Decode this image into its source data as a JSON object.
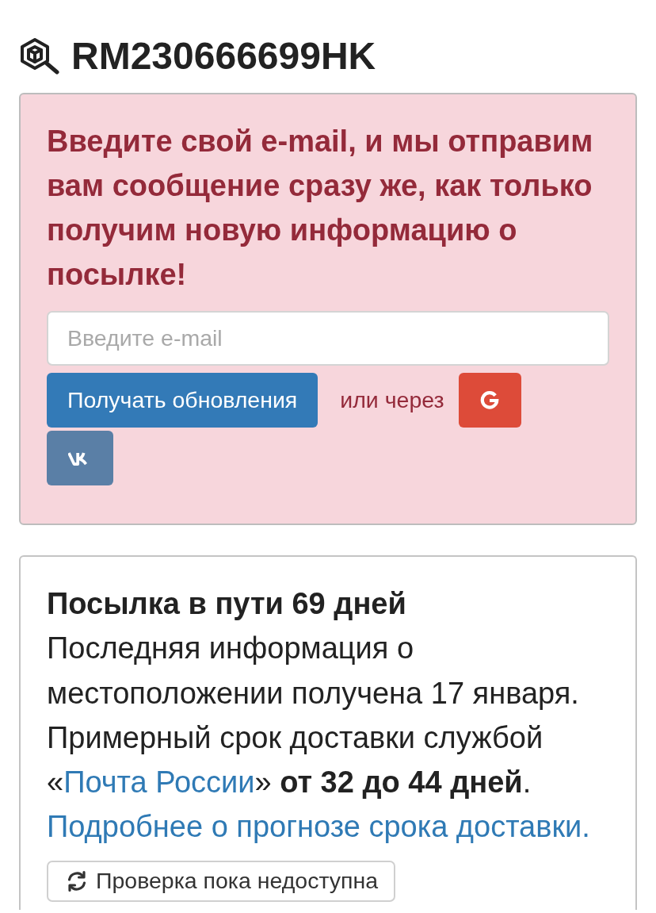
{
  "header": {
    "title": "RM230666699HK"
  },
  "subscribe": {
    "message": "Введите свой e-mail, и мы отправим вам сообщение сразу же, как только получим новую информацию о посылке!",
    "email": {
      "placeholder": "Введите e-mail"
    },
    "submit": "Получать обновления",
    "alt_label": "или через",
    "social": [
      {
        "kind": "google"
      },
      {
        "kind": "vk"
      }
    ]
  },
  "status": {
    "title": "Посылка в пути 69 дней",
    "text_before": "Последняя информация о местоположении получена 17 января. Примерный срок доставки службой «",
    "link": "Почта России",
    "text_after": "» **от 32 до 44 дней**.",
    "details_link": "Подробнее о прогнозе срока доставки.",
    "check_button": "Проверка пока недоступна"
  }
}
